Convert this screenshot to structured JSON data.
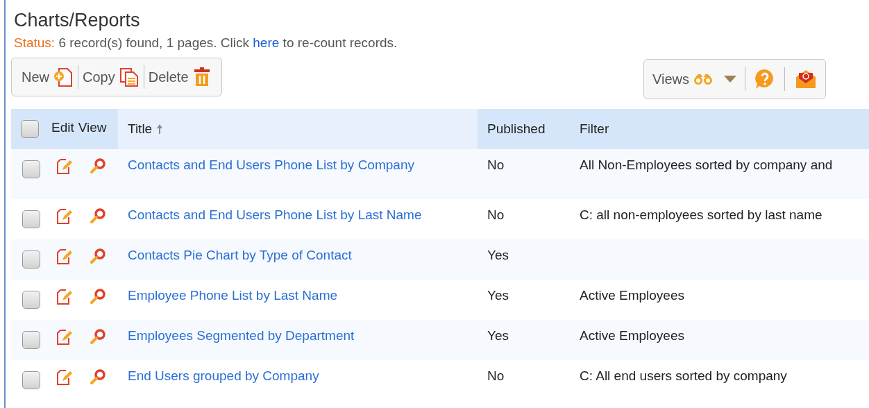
{
  "page": {
    "title": "Charts/Reports"
  },
  "status": {
    "label": "Status:",
    "text_before": "6 record(s) found, 1 pages. Click",
    "link": "here",
    "text_after": "to re-count records."
  },
  "toolbar_left": [
    {
      "label": "New",
      "kind": "new"
    },
    {
      "label": "Copy",
      "kind": "copy"
    },
    {
      "label": "Delete",
      "kind": "delete"
    }
  ],
  "toolbar_right": {
    "views": "Views"
  },
  "table": {
    "select_all_checked": false,
    "columns": [
      {
        "label": "Edit"
      },
      {
        "label": "View"
      },
      {
        "label": "Title",
        "sorted": true
      },
      {
        "label": "Published",
        "sorted": false
      },
      {
        "label": "Filter",
        "sorted": false
      }
    ],
    "rows": [
      {
        "checked": false,
        "title": "Contacts and End Users Phone List by Company",
        "published": "No",
        "filter": "All Non-Employees sorted by company and"
      },
      {
        "checked": false,
        "title": "Contacts and End Users Phone List by Last Name",
        "published": "No",
        "filter": "C: all non-employees sorted by last name"
      },
      {
        "checked": false,
        "title": "Contacts Pie Chart by Type of Contact",
        "published": "Yes"
      },
      {
        "checked": false,
        "title": "Employee Phone List by Last Name",
        "published": "Yes",
        "filter": "Active Employees"
      },
      {
        "checked": false,
        "title": "Employees Segmented by Department",
        "published": "Yes",
        "filter": "Active Employees"
      },
      {
        "checked": false,
        "title": "End Users grouped by Company",
        "published": "No",
        "filter": "C: All end users sorted by company"
      }
    ]
  }
}
